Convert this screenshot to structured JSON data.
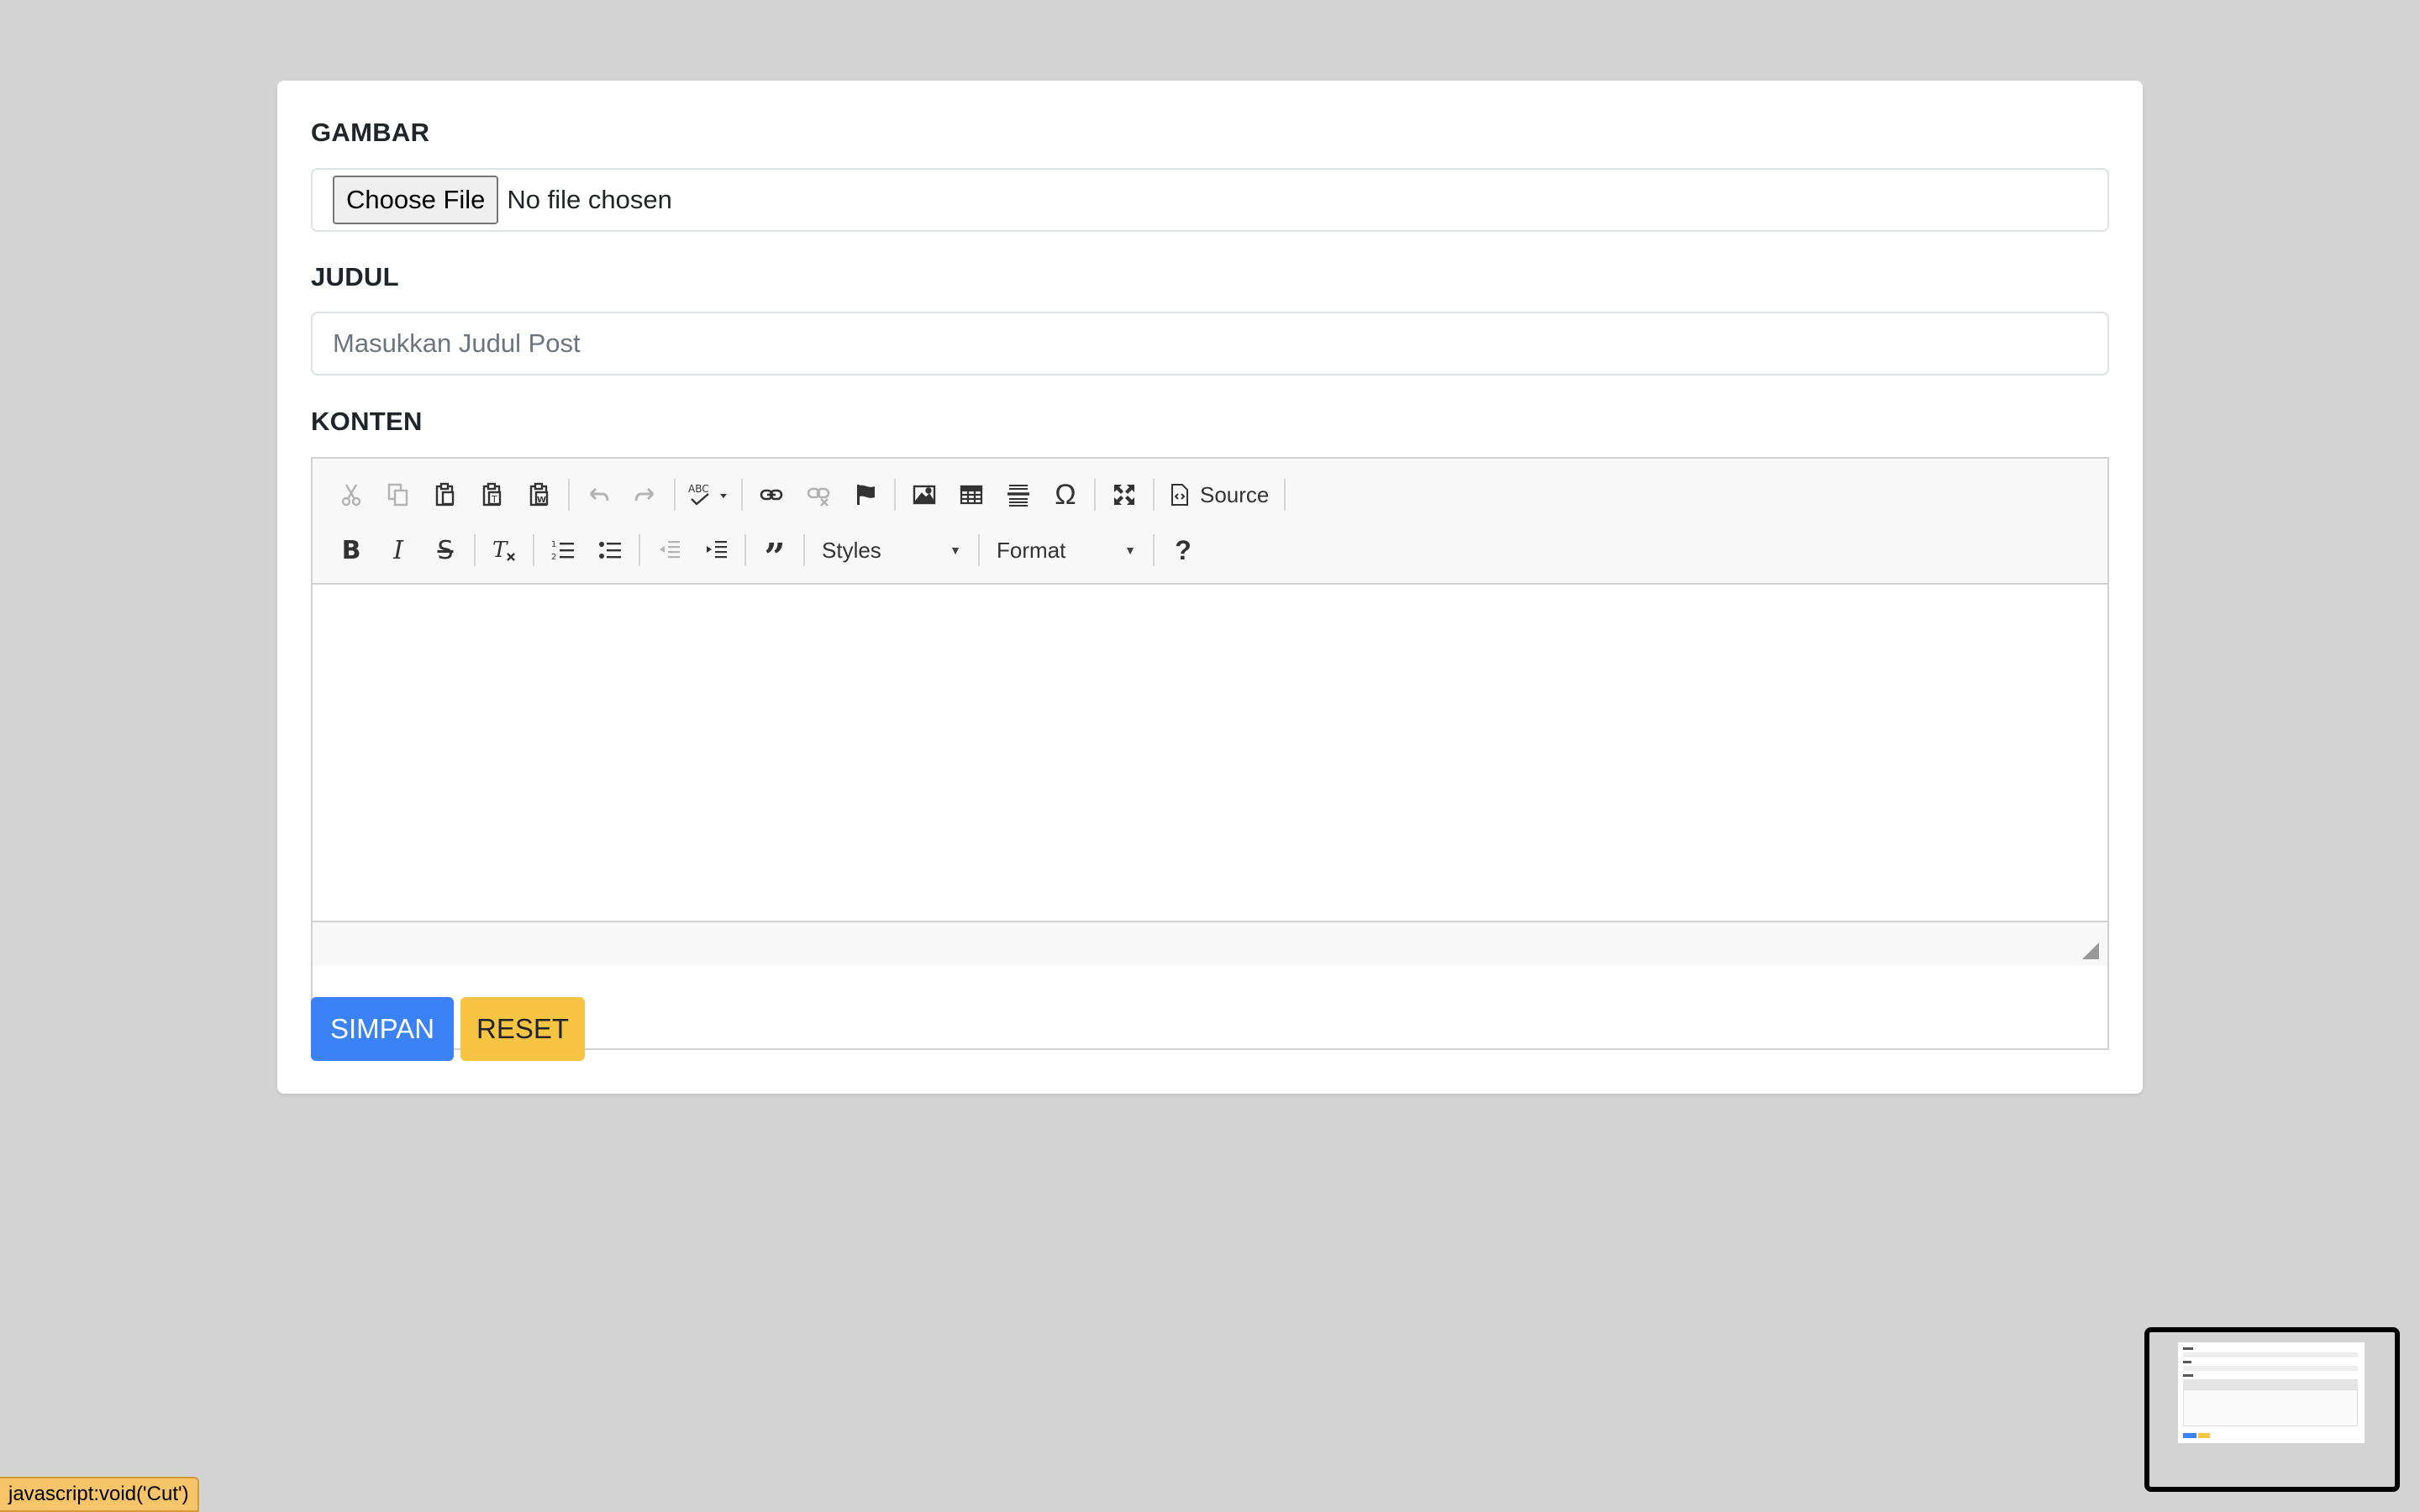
{
  "form": {
    "gambar_label": "GAMBAR",
    "choose_file_label": "Choose File",
    "file_status": "No file chosen",
    "judul_label": "JUDUL",
    "judul_placeholder": "Masukkan Judul Post",
    "judul_value": "",
    "konten_label": "KONTEN"
  },
  "editor": {
    "toolbar_row1": [
      {
        "name": "cut-icon",
        "disabled": true
      },
      {
        "name": "copy-icon",
        "disabled": true
      },
      {
        "name": "paste-icon",
        "disabled": false
      },
      {
        "name": "paste-text-icon",
        "disabled": false
      },
      {
        "name": "paste-word-icon",
        "disabled": false
      },
      {
        "name": "undo-icon",
        "disabled": true
      },
      {
        "name": "redo-icon",
        "disabled": true
      },
      {
        "name": "spellcheck-icon",
        "disabled": false
      },
      {
        "name": "link-icon",
        "disabled": false
      },
      {
        "name": "unlink-icon",
        "disabled": true
      },
      {
        "name": "anchor-flag-icon",
        "disabled": false
      },
      {
        "name": "image-icon",
        "disabled": false
      },
      {
        "name": "table-icon",
        "disabled": false
      },
      {
        "name": "horizontal-line-icon",
        "disabled": false
      },
      {
        "name": "special-char-icon",
        "disabled": false
      },
      {
        "name": "maximize-icon",
        "disabled": false
      }
    ],
    "source_label": "Source",
    "toolbar_row2": [
      {
        "name": "bold-icon"
      },
      {
        "name": "italic-icon"
      },
      {
        "name": "strikethrough-icon"
      },
      {
        "name": "remove-format-icon"
      },
      {
        "name": "numbered-list-icon"
      },
      {
        "name": "bulleted-list-icon"
      },
      {
        "name": "outdent-icon"
      },
      {
        "name": "indent-icon"
      },
      {
        "name": "blockquote-icon"
      }
    ],
    "styles_label": "Styles",
    "format_label": "Format",
    "help_label": "?"
  },
  "actions": {
    "save_label": "SIMPAN",
    "reset_label": "RESET"
  },
  "status_bar": {
    "url": "javascript:void('Cut')"
  },
  "colors": {
    "primary": "#3b82f6",
    "warning": "#f7c443",
    "background": "#d3d3d3"
  }
}
